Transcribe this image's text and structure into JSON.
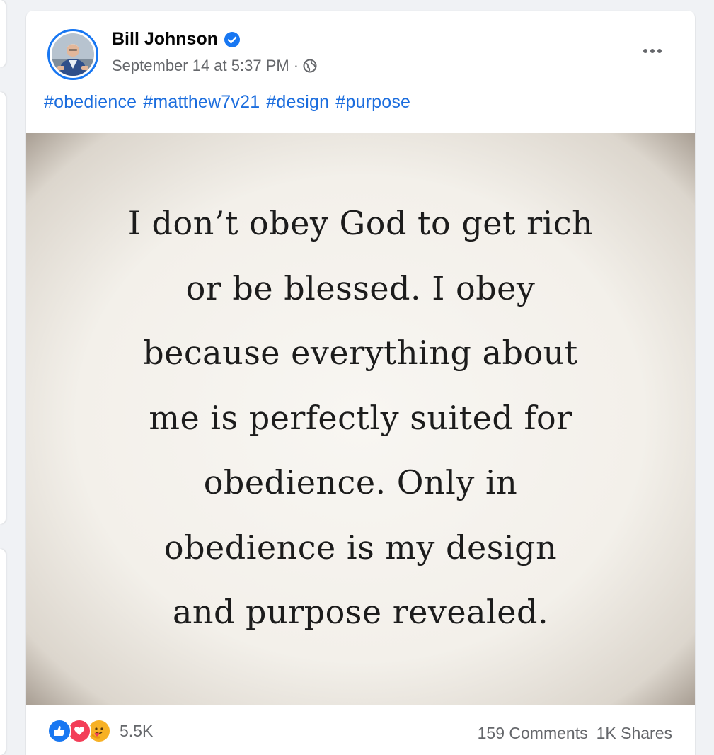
{
  "post": {
    "author": "Bill Johnson",
    "timestamp": "September 14 at 5:37 PM",
    "separator": "·",
    "privacy_icon": "globe-icon",
    "verified_icon": "verified-badge-icon",
    "more_icon": "more-options-icon",
    "hashtags": [
      "#obedience",
      "#matthew7v21",
      "#design",
      "#purpose"
    ],
    "image_quote_lines": [
      "I don’t obey God to get rich",
      "or be blessed. I obey",
      "because everything about",
      "me is perfectly suited for",
      "obedience. Only in",
      "obedience is my design",
      "and purpose revealed."
    ],
    "reactions": {
      "icons": [
        "like-icon",
        "love-icon",
        "care-icon"
      ],
      "count": "5.5K"
    },
    "comments": "159 Comments",
    "shares": "1K Shares"
  },
  "colors": {
    "brand": "#1877f2",
    "hashtag": "#1b6dde",
    "secondary_text": "#65676b",
    "like": "#1877f2",
    "love": "#f33e58",
    "care": "#f7b125"
  }
}
